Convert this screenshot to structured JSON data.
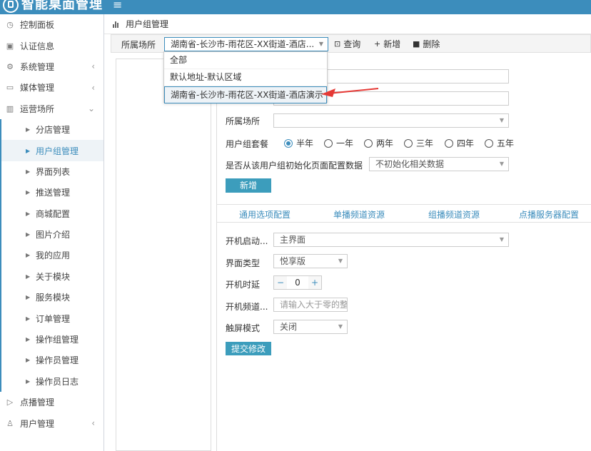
{
  "app": {
    "title": "智能桌面管理",
    "menu_icon": "≡"
  },
  "sidebar": {
    "items": [
      {
        "label": "控制面板",
        "icon": "dashboard-icon"
      },
      {
        "label": "认证信息",
        "icon": "idcard-icon"
      },
      {
        "label": "系统管理",
        "icon": "gear-icon",
        "chevron": "‹"
      },
      {
        "label": "媒体管理",
        "icon": "monitor-icon",
        "chevron": "‹"
      },
      {
        "label": "运营场所",
        "icon": "building-icon",
        "chevron": "⌄"
      }
    ],
    "sub_items": [
      "分店管理",
      "用户组管理",
      "界面列表",
      "推送管理",
      "商城配置",
      "图片介绍",
      "我的应用",
      "关于模块",
      "服务模块",
      "订单管理",
      "操作组管理",
      "操作员管理",
      "操作员日志"
    ],
    "bottom_items": [
      {
        "label": "点播管理",
        "icon": "play-icon"
      },
      {
        "label": "用户管理",
        "icon": "user-icon",
        "chevron": "‹"
      }
    ]
  },
  "breadcrumb": {
    "text": "用户组管理"
  },
  "toolbar": {
    "venue_label": "所属场所",
    "venue_value": "湖南省-长沙市-雨花区-XX街道-酒店...",
    "query_label": "查询",
    "add_label": "新增",
    "delete_label": "删除"
  },
  "dropdown": {
    "options": [
      "全部",
      "默认地址-默认区域",
      "湖南省-长沙市-雨花区-XX街道-酒店演示"
    ]
  },
  "form": {
    "venue_label": "所属场所",
    "package_label": "用户组套餐",
    "package_options": [
      "半年",
      "一年",
      "两年",
      "三年",
      "四年",
      "五年"
    ],
    "package_selected": "半年",
    "init_label": "是否从该用户组初始化页面配置数据",
    "init_value": "不初始化相关数据",
    "add_button": "新增"
  },
  "tabs": [
    "通用选项配置",
    "单播频道资源",
    "组播频道资源",
    "点播服务器配置"
  ],
  "config": {
    "boot_label": "开机启动...",
    "boot_value": "主界面",
    "ui_type_label": "界面类型",
    "ui_type_value": "悦享版",
    "delay_label": "开机时延",
    "delay_value": "0",
    "channel_label": "开机频道...",
    "channel_placeholder": "请输入大于零的整",
    "touch_label": "触屏模式",
    "touch_value": "关闭",
    "submit_button": "提交修改"
  },
  "colors": {
    "brand": "#3c8dbc",
    "button": "#3c9dbc",
    "annotation": "#e53935"
  }
}
